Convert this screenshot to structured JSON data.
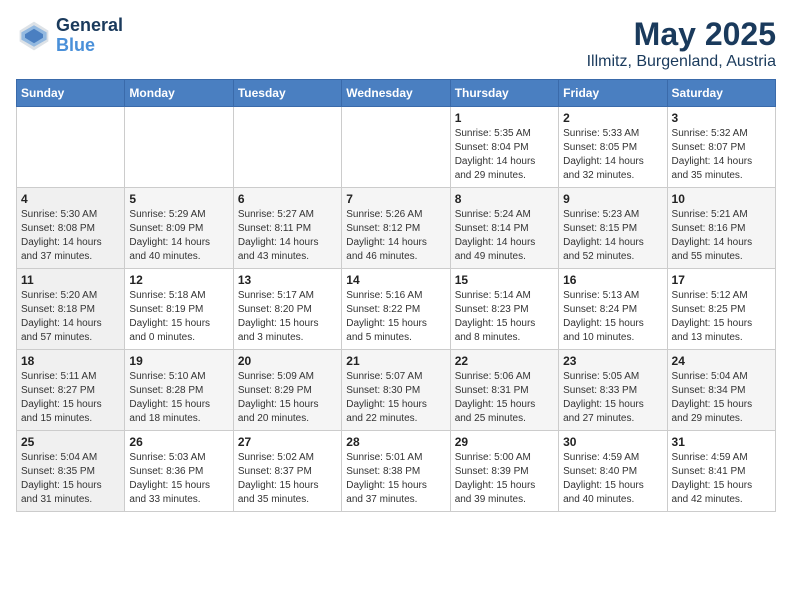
{
  "logo": {
    "line1": "General",
    "line2": "Blue"
  },
  "title": "May 2025",
  "subtitle": "Illmitz, Burgenland, Austria",
  "days_of_week": [
    "Sunday",
    "Monday",
    "Tuesday",
    "Wednesday",
    "Thursday",
    "Friday",
    "Saturday"
  ],
  "weeks": [
    [
      {
        "num": "",
        "info": ""
      },
      {
        "num": "",
        "info": ""
      },
      {
        "num": "",
        "info": ""
      },
      {
        "num": "",
        "info": ""
      },
      {
        "num": "1",
        "info": "Sunrise: 5:35 AM\nSunset: 8:04 PM\nDaylight: 14 hours\nand 29 minutes."
      },
      {
        "num": "2",
        "info": "Sunrise: 5:33 AM\nSunset: 8:05 PM\nDaylight: 14 hours\nand 32 minutes."
      },
      {
        "num": "3",
        "info": "Sunrise: 5:32 AM\nSunset: 8:07 PM\nDaylight: 14 hours\nand 35 minutes."
      }
    ],
    [
      {
        "num": "4",
        "info": "Sunrise: 5:30 AM\nSunset: 8:08 PM\nDaylight: 14 hours\nand 37 minutes."
      },
      {
        "num": "5",
        "info": "Sunrise: 5:29 AM\nSunset: 8:09 PM\nDaylight: 14 hours\nand 40 minutes."
      },
      {
        "num": "6",
        "info": "Sunrise: 5:27 AM\nSunset: 8:11 PM\nDaylight: 14 hours\nand 43 minutes."
      },
      {
        "num": "7",
        "info": "Sunrise: 5:26 AM\nSunset: 8:12 PM\nDaylight: 14 hours\nand 46 minutes."
      },
      {
        "num": "8",
        "info": "Sunrise: 5:24 AM\nSunset: 8:14 PM\nDaylight: 14 hours\nand 49 minutes."
      },
      {
        "num": "9",
        "info": "Sunrise: 5:23 AM\nSunset: 8:15 PM\nDaylight: 14 hours\nand 52 minutes."
      },
      {
        "num": "10",
        "info": "Sunrise: 5:21 AM\nSunset: 8:16 PM\nDaylight: 14 hours\nand 55 minutes."
      }
    ],
    [
      {
        "num": "11",
        "info": "Sunrise: 5:20 AM\nSunset: 8:18 PM\nDaylight: 14 hours\nand 57 minutes."
      },
      {
        "num": "12",
        "info": "Sunrise: 5:18 AM\nSunset: 8:19 PM\nDaylight: 15 hours\nand 0 minutes."
      },
      {
        "num": "13",
        "info": "Sunrise: 5:17 AM\nSunset: 8:20 PM\nDaylight: 15 hours\nand 3 minutes."
      },
      {
        "num": "14",
        "info": "Sunrise: 5:16 AM\nSunset: 8:22 PM\nDaylight: 15 hours\nand 5 minutes."
      },
      {
        "num": "15",
        "info": "Sunrise: 5:14 AM\nSunset: 8:23 PM\nDaylight: 15 hours\nand 8 minutes."
      },
      {
        "num": "16",
        "info": "Sunrise: 5:13 AM\nSunset: 8:24 PM\nDaylight: 15 hours\nand 10 minutes."
      },
      {
        "num": "17",
        "info": "Sunrise: 5:12 AM\nSunset: 8:25 PM\nDaylight: 15 hours\nand 13 minutes."
      }
    ],
    [
      {
        "num": "18",
        "info": "Sunrise: 5:11 AM\nSunset: 8:27 PM\nDaylight: 15 hours\nand 15 minutes."
      },
      {
        "num": "19",
        "info": "Sunrise: 5:10 AM\nSunset: 8:28 PM\nDaylight: 15 hours\nand 18 minutes."
      },
      {
        "num": "20",
        "info": "Sunrise: 5:09 AM\nSunset: 8:29 PM\nDaylight: 15 hours\nand 20 minutes."
      },
      {
        "num": "21",
        "info": "Sunrise: 5:07 AM\nSunset: 8:30 PM\nDaylight: 15 hours\nand 22 minutes."
      },
      {
        "num": "22",
        "info": "Sunrise: 5:06 AM\nSunset: 8:31 PM\nDaylight: 15 hours\nand 25 minutes."
      },
      {
        "num": "23",
        "info": "Sunrise: 5:05 AM\nSunset: 8:33 PM\nDaylight: 15 hours\nand 27 minutes."
      },
      {
        "num": "24",
        "info": "Sunrise: 5:04 AM\nSunset: 8:34 PM\nDaylight: 15 hours\nand 29 minutes."
      }
    ],
    [
      {
        "num": "25",
        "info": "Sunrise: 5:04 AM\nSunset: 8:35 PM\nDaylight: 15 hours\nand 31 minutes."
      },
      {
        "num": "26",
        "info": "Sunrise: 5:03 AM\nSunset: 8:36 PM\nDaylight: 15 hours\nand 33 minutes."
      },
      {
        "num": "27",
        "info": "Sunrise: 5:02 AM\nSunset: 8:37 PM\nDaylight: 15 hours\nand 35 minutes."
      },
      {
        "num": "28",
        "info": "Sunrise: 5:01 AM\nSunset: 8:38 PM\nDaylight: 15 hours\nand 37 minutes."
      },
      {
        "num": "29",
        "info": "Sunrise: 5:00 AM\nSunset: 8:39 PM\nDaylight: 15 hours\nand 39 minutes."
      },
      {
        "num": "30",
        "info": "Sunrise: 4:59 AM\nSunset: 8:40 PM\nDaylight: 15 hours\nand 40 minutes."
      },
      {
        "num": "31",
        "info": "Sunrise: 4:59 AM\nSunset: 8:41 PM\nDaylight: 15 hours\nand 42 minutes."
      }
    ]
  ]
}
